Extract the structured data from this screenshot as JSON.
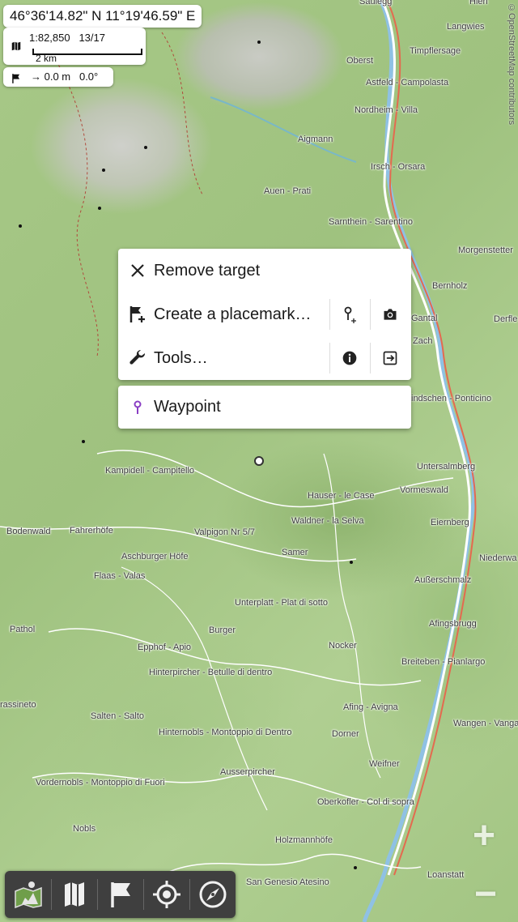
{
  "header": {
    "coordinates": "46°36'14.82\" N 11°19'46.59\" E",
    "scale": "1:82,850",
    "zoom_level": "13/17",
    "scale_bar_label": "2 km",
    "distance": "→ 0.0 m",
    "bearing": "0.0°"
  },
  "attribution": "©OpenStreetMap contributors",
  "map_labels": [
    "Saulegg",
    "Hien",
    "Langwies",
    "Oberst",
    "Timpflersage",
    "Astfeld - Campolasta",
    "Nordheim - Villa",
    "Aigmann",
    "Irsch - Orsara",
    "Auen - Prati",
    "Sarnthein - Sarentino",
    "Morgenstetter",
    "Bernholz",
    "Gantal",
    "Derfle",
    "Zach",
    "indschen - Ponticino",
    "Untersalmberg",
    "Kampidell - Campitello",
    "Hauser - le Case",
    "Vormeswald",
    "Waldner - la Selva",
    "Eiernberg",
    "Bodenwald",
    "Fahrerhöfe",
    "Valpigon Nr 5/7",
    "Niederwa",
    "Samer",
    "Aschburger Höfe",
    "Flaas - Valas",
    "Außerschmalz",
    "Unterplatt - Plat di sotto",
    "Afingsbrugg",
    "Pathol",
    "Burger",
    "Epphof - Apio",
    "Nocker",
    "Breiteben - Pianlargo",
    "Hinterpircher - Betulle di dentro",
    "rassineto",
    "Afing - Avigna",
    "Salten - Salto",
    "Wangen - Vanga",
    "Hinternobls - Montoppio di Dentro",
    "Dorner",
    "Weifner",
    "Ausserpircher",
    "Vordernobls - Montoppio di Fuori",
    "Oberkofler - Col di sopra",
    "Nobls",
    "Holzmannhöfe",
    "Loanstatt",
    "San Genesio Atesino"
  ],
  "context_menu": {
    "remove_target": "Remove target",
    "create_placemark": "Create a placemark…",
    "tools": "Tools…"
  },
  "waypoint_menu": {
    "waypoint": "Waypoint"
  },
  "zoom": {
    "plus": "+",
    "minus": "−"
  },
  "icons": {
    "close": "close-icon",
    "add_flag": "add-flag-icon",
    "add_pin": "add-pin-icon",
    "camera": "camera-icon",
    "wrench": "wrench-icon",
    "info": "info-icon",
    "export": "export-icon",
    "waypoint_pin": "waypoint-pin-icon",
    "toolbar": [
      "maps-icon",
      "map-icon",
      "flag-icon",
      "gps-target-icon",
      "compass-icon"
    ]
  },
  "colors": {
    "waypoint_pin": "#8a3fc4",
    "toolbar_bg": "#3f3f3f",
    "map_green": "#a7c887"
  }
}
